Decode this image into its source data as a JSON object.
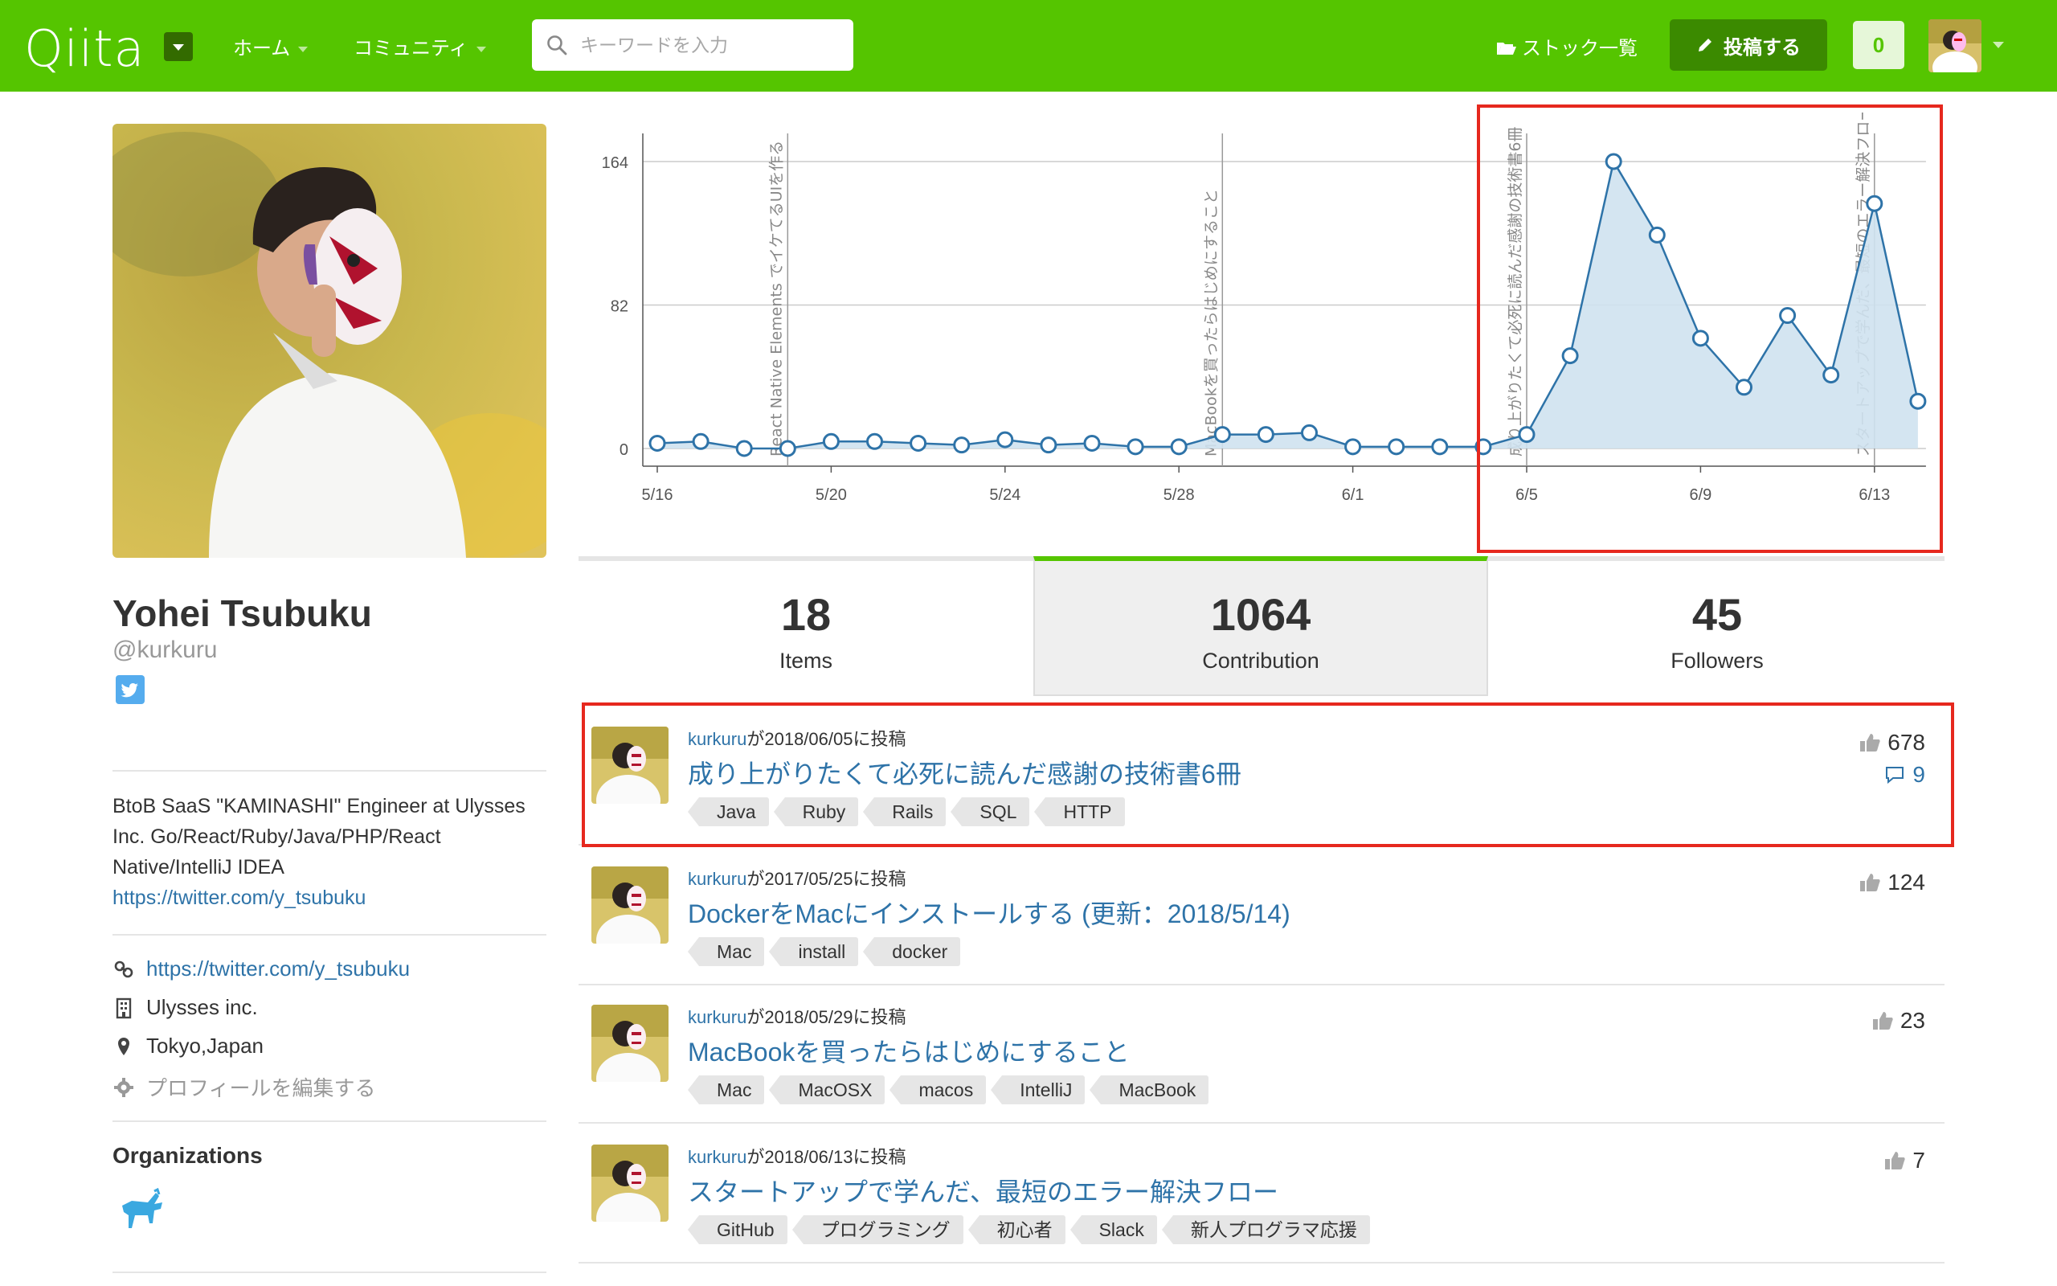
{
  "header": {
    "logo": "Qiita",
    "nav": [
      "ホーム",
      "コミュニティ"
    ],
    "search_placeholder": "キーワードを入力",
    "stock_label": "ストック一覧",
    "post_label": "投稿する",
    "notification_count": "0"
  },
  "profile": {
    "name": "Yohei Tsubuku",
    "handle": "@kurkuru",
    "bio": "BtoB SaaS \"KAMINASHI\" Engineer at Ulysses Inc. Go/React/Ruby/Java/PHP/React Native/IntelliJ IDEA",
    "bio_link": "https://twitter.com/y_tsubuku",
    "website": "https://twitter.com/y_tsubuku",
    "company": "Ulysses inc.",
    "location": "Tokyo,Japan",
    "edit_label": "プロフィールを編集する",
    "organizations_title": "Organizations"
  },
  "chart_data": {
    "type": "area",
    "x": [
      "5/16",
      "5/17",
      "5/18",
      "5/19",
      "5/20",
      "5/21",
      "5/22",
      "5/23",
      "5/24",
      "5/25",
      "5/26",
      "5/27",
      "5/28",
      "5/29",
      "5/30",
      "5/31",
      "6/1",
      "6/2",
      "6/3",
      "6/4",
      "6/5",
      "6/6",
      "6/7",
      "6/8",
      "6/9",
      "6/10",
      "6/11",
      "6/12",
      "6/13",
      "6/14"
    ],
    "values": [
      3,
      4,
      0,
      0,
      4,
      4,
      3,
      2,
      5,
      2,
      3,
      1,
      1,
      8,
      8,
      9,
      1,
      1,
      1,
      1,
      8,
      53,
      164,
      122,
      63,
      35,
      76,
      42,
      140,
      27
    ],
    "x_ticks": [
      "5/16",
      "5/20",
      "5/24",
      "5/28",
      "6/1",
      "6/5",
      "6/9",
      "6/13"
    ],
    "y_ticks": [
      "164",
      "82",
      "0"
    ],
    "ylim": [
      0,
      164
    ],
    "annotations": [
      {
        "x": "5/19",
        "label": "React Native Elements でイケてるUIを作る"
      },
      {
        "x": "5/29",
        "label": "MacBookを買ったらはじめにすること"
      },
      {
        "x": "6/5",
        "label": "成り上がりたくて必死に読んだ感謝の技術書6冊"
      },
      {
        "x": "6/13",
        "label": "スタートアップで学んだ、最短のエラー解決フロー"
      }
    ],
    "colors": {
      "line": "#2e73a8",
      "fill": "#cfe2f0",
      "highlight": "#e6281e"
    }
  },
  "stats": [
    {
      "num": "18",
      "label": "Items"
    },
    {
      "num": "1064",
      "label": "Contribution"
    },
    {
      "num": "45",
      "label": "Followers"
    }
  ],
  "items": [
    {
      "user": "kurkuru",
      "meta": "が2018/06/05に投稿",
      "title": "成り上がりたくて必死に読んだ感謝の技術書6冊",
      "tags": [
        "Java",
        "Ruby",
        "Rails",
        "SQL",
        "HTTP"
      ],
      "likes": "678",
      "comments": "9"
    },
    {
      "user": "kurkuru",
      "meta": "が2017/05/25に投稿",
      "title": "DockerをMacにインストールする (更新：2018/5/14)",
      "tags": [
        "Mac",
        "install",
        "docker"
      ],
      "likes": "124",
      "comments": ""
    },
    {
      "user": "kurkuru",
      "meta": "が2018/05/29に投稿",
      "title": "MacBookを買ったらはじめにすること",
      "tags": [
        "Mac",
        "MacOSX",
        "macos",
        "IntelliJ",
        "MacBook"
      ],
      "likes": "23",
      "comments": ""
    },
    {
      "user": "kurkuru",
      "meta": "が2018/06/13に投稿",
      "title": "スタートアップで学んだ、最短のエラー解決フロー",
      "tags": [
        "GitHub",
        "プログラミング",
        "初心者",
        "Slack",
        "新人プログラマ応援"
      ],
      "likes": "7",
      "comments": ""
    }
  ]
}
